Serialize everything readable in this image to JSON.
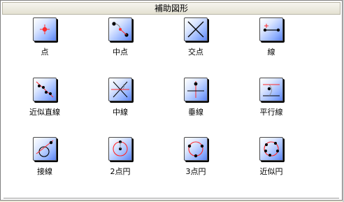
{
  "window": {
    "title": "補助図形"
  },
  "tools": [
    {
      "id": "point",
      "label": "点",
      "icon": "point-icon"
    },
    {
      "id": "midpoint",
      "label": "中点",
      "icon": "midpoint-icon"
    },
    {
      "id": "intersection",
      "label": "交点",
      "icon": "intersection-icon"
    },
    {
      "id": "line",
      "label": "線",
      "icon": "line-icon"
    },
    {
      "id": "approx-line",
      "label": "近似直線",
      "icon": "approx-line-icon"
    },
    {
      "id": "mid-line",
      "label": "中線",
      "icon": "mid-line-icon"
    },
    {
      "id": "perpendicular",
      "label": "垂線",
      "icon": "perpendicular-icon"
    },
    {
      "id": "parallel",
      "label": "平行線",
      "icon": "parallel-icon"
    },
    {
      "id": "tangent",
      "label": "接線",
      "icon": "tangent-icon"
    },
    {
      "id": "two-point-circle",
      "label": "2点円",
      "icon": "two-point-circle-icon"
    },
    {
      "id": "three-point-circle",
      "label": "3点円",
      "icon": "three-point-circle-icon"
    },
    {
      "id": "approx-circle",
      "label": "近似円",
      "icon": "approx-circle-icon"
    }
  ]
}
